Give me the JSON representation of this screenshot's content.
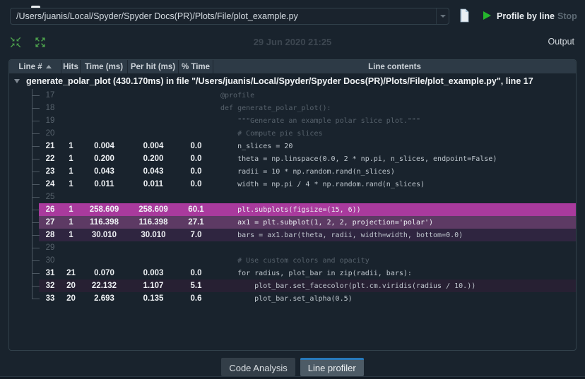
{
  "toolbar": {
    "path_value": "/Users/juanis/Local/Spyder/Spyder Docs(PR)/Plots/File/plot_example.py",
    "profile_label": "Profile by line",
    "stop_label": "Stop"
  },
  "subbar": {
    "timestamp": "29 Jun 2020 21:25",
    "output_label": "Output"
  },
  "table": {
    "columns": [
      "Line #",
      "Hits",
      "Time (ms)",
      "Per hit (ms)",
      "% Time",
      "Line contents"
    ],
    "root": "generate_polar_plot (430.170ms) in file \"/Users/juanis/Local/Spyder/Spyder Docs(PR)/Plots/File/plot_example.py\", line 17",
    "rows": [
      {
        "line": 17,
        "hits": "",
        "time": "",
        "per_hit": "",
        "pct": "",
        "code": "@profile",
        "state": "nohit"
      },
      {
        "line": 18,
        "hits": "",
        "time": "",
        "per_hit": "",
        "pct": "",
        "code": "def generate_polar_plot():",
        "state": "nohit"
      },
      {
        "line": 19,
        "hits": "",
        "time": "",
        "per_hit": "",
        "pct": "",
        "code": "    \"\"\"Generate an example polar slice plot.\"\"\"",
        "state": "nohit"
      },
      {
        "line": 20,
        "hits": "",
        "time": "",
        "per_hit": "",
        "pct": "",
        "code": "    # Compute pie slices",
        "state": "nohit"
      },
      {
        "line": 21,
        "hits": "1",
        "time": "0.004",
        "per_hit": "0.004",
        "pct": "0.0",
        "code": "    n_slices = 20",
        "state": "hit"
      },
      {
        "line": 22,
        "hits": "1",
        "time": "0.200",
        "per_hit": "0.200",
        "pct": "0.0",
        "code": "    theta = np.linspace(0.0, 2 * np.pi, n_slices, endpoint=False)",
        "state": "hit"
      },
      {
        "line": 23,
        "hits": "1",
        "time": "0.043",
        "per_hit": "0.043",
        "pct": "0.0",
        "code": "    radii = 10 * np.random.rand(n_slices)",
        "state": "hit"
      },
      {
        "line": 24,
        "hits": "1",
        "time": "0.011",
        "per_hit": "0.011",
        "pct": "0.0",
        "code": "    width = np.pi / 4 * np.random.rand(n_slices)",
        "state": "hit"
      },
      {
        "line": 25,
        "hits": "",
        "time": "",
        "per_hit": "",
        "pct": "",
        "code": "",
        "state": "nohit"
      },
      {
        "line": 26,
        "hits": "1",
        "time": "258.609",
        "per_hit": "258.609",
        "pct": "60.1",
        "code": "    plt.subplots(figsize=(15, 6))",
        "state": "hit",
        "highlight": "high"
      },
      {
        "line": 27,
        "hits": "1",
        "time": "116.398",
        "per_hit": "116.398",
        "pct": "27.1",
        "code": "    ax1 = plt.subplot(1, 2, 2, projection='polar')",
        "state": "hit",
        "highlight": "mid"
      },
      {
        "line": 28,
        "hits": "1",
        "time": "30.010",
        "per_hit": "30.010",
        "pct": "7.0",
        "code": "    bars = ax1.bar(theta, radii, width=width, bottom=0.0)",
        "state": "hit",
        "highlight": "low"
      },
      {
        "line": 29,
        "hits": "",
        "time": "",
        "per_hit": "",
        "pct": "",
        "code": "",
        "state": "nohit"
      },
      {
        "line": 30,
        "hits": "",
        "time": "",
        "per_hit": "",
        "pct": "",
        "code": "    # Use custom colors and opacity",
        "state": "nohit"
      },
      {
        "line": 31,
        "hits": "21",
        "time": "0.070",
        "per_hit": "0.003",
        "pct": "0.0",
        "code": "    for radius, plot_bar in zip(radii, bars):",
        "state": "hit"
      },
      {
        "line": 32,
        "hits": "20",
        "time": "22.132",
        "per_hit": "1.107",
        "pct": "5.1",
        "code": "        plot_bar.set_facecolor(plt.cm.viridis(radius / 10.))",
        "state": "hit",
        "highlight": "faint"
      },
      {
        "line": 33,
        "hits": "20",
        "time": "2.693",
        "per_hit": "0.135",
        "pct": "0.6",
        "code": "        plot_bar.set_alpha(0.5)",
        "state": "hit"
      }
    ]
  },
  "tabs": [
    {
      "label": "Code Analysis",
      "active": false
    },
    {
      "label": "Line profiler",
      "active": true
    }
  ],
  "colors": {
    "background": "#19232d",
    "frame_border": "#32414b",
    "header_bg": "#2d3a46",
    "hl_high": "#a93a9d",
    "hl_mid": "#5d3a64",
    "hl_low": "#2f2540",
    "hl_faint": "#272033",
    "accent_green": "#4da14d",
    "play_green": "#25b52c",
    "tab_accent": "#2879ba"
  }
}
